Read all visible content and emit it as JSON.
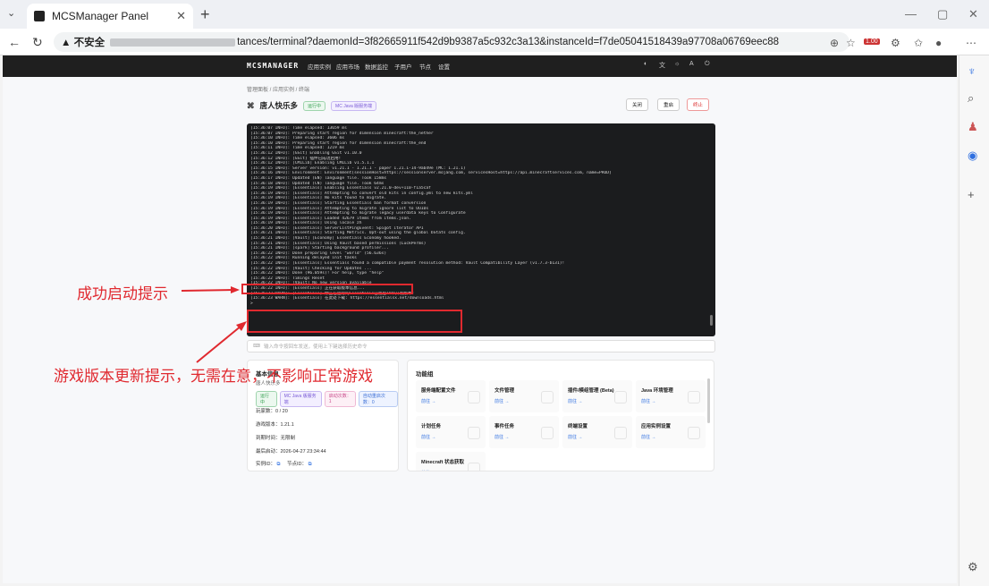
{
  "browser": {
    "tab_title": "MCSManager Panel",
    "security_label": "不安全",
    "url_visible": "tances/terminal?daemonId=3f82665911f542d9b9387a5c932c3a13&instanceId=f7de05041518439a97708a06769eec88",
    "window_controls": [
      "—",
      "▢",
      "✕"
    ],
    "extension_badge": "1.00"
  },
  "app": {
    "brand": "MCSMANAGER",
    "nav": [
      "应用实例",
      "应用市场",
      "数据监控",
      "子用户",
      "节点",
      "设置"
    ]
  },
  "breadcrumb": "管理面板  /  应用实例  /  终端",
  "instance": {
    "name": "唐人快乐多",
    "status_badge": "运行中",
    "type_badge": "MC Java 版服务端",
    "buttons": {
      "close": "关闭",
      "restart": "重启",
      "stop": "终止"
    }
  },
  "terminal": {
    "lines": [
      {
        "t": "[15:36:07 INFO]: Time elapsed: 13659 ms",
        "c": ""
      },
      {
        "t": "[15:36:07 INFO]: Preparing start region for dimension minecraft:the_nether",
        "c": ""
      },
      {
        "t": "[15:36:10 INFO]: Time elapsed: 3606 ms",
        "c": ""
      },
      {
        "t": "[15:36:10 INFO]: Preparing start region for dimension minecraft:the_end",
        "c": ""
      },
      {
        "t": "[15:36:11 INFO]: Time elapsed: 1219 ms",
        "c": ""
      },
      {
        "t": "[15:36:12 INFO]: [GSit] Enabling GSit v1.10.0",
        "c": ""
      },
      {
        "t": "[15:36:12 INFO]: [GSit] 插件已成功启用!",
        "c": "ylw"
      },
      {
        "t": "[15:36:12 INFO]: [CMILib] Enabling CMILib v1.5.1.1",
        "c": ""
      },
      {
        "t": "[15:36:15 INFO]: Server version: v1.21.1 - 1.21.1 - paper 1.21.1-14-9ab49e (MC: 1.21.1)",
        "c": ""
      },
      {
        "t": "[15:36:16 INFO]: Environment: Environment[sessionHost=https://sessionserver.mojang.com, servicesHost=https://api.minecraftservices.com, name=PROD]",
        "c": ""
      },
      {
        "t": "[15:36:17 INFO]: Updated (EN) language file. Took 158ms",
        "c": ""
      },
      {
        "t": "[15:36:18 INFO]: Updated (CN) language file. Took 64ms",
        "c": ""
      },
      {
        "t": "[15:36:19 INFO]: [Essentials] Enabling Essentials v2.21.0-dev+110-f1a5caf",
        "c": ""
      },
      {
        "t": "[15:36:19 INFO]: [Essentials] Attempting to convert old kits in config.yml to new kits.yml",
        "c": ""
      },
      {
        "t": "[15:36:19 INFO]: [Essentials] No kits found to migrate.",
        "c": ""
      },
      {
        "t": "[15:36:19 INFO]: [Essentials] Starting Essentials ban format conversion",
        "c": ""
      },
      {
        "t": "[15:36:19 INFO]: [Essentials] Attempting to migrate ignore list to UUIDs",
        "c": ""
      },
      {
        "t": "[15:36:19 INFO]: [Essentials] Attempting to migrate legacy userdata keys to Configurate",
        "c": ""
      },
      {
        "t": "[15:36:19 INFO]: [Essentials] Loaded 42679 items from items.json.",
        "c": ""
      },
      {
        "t": "[15:36:19 INFO]: [Essentials] Using locale zh",
        "c": ""
      },
      {
        "t": "[15:36:20 INFO]: [Essentials] ServerListPingEvent: Spigot iterator API",
        "c": ""
      },
      {
        "t": "[15:36:21 INFO]: [Essentials] Starting Metrics. Opt-out using the global bStats config.",
        "c": ""
      },
      {
        "t": "[15:36:21 INFO]: [Vault] [Economy] Essentials Economy hooked.",
        "c": ""
      },
      {
        "t": "[15:36:21 INFO]: [Essentials] Using Vault based permissions (LuckPerms)",
        "c": ""
      },
      {
        "t": "[15:36:21 INFO]: [spark] Starting background profiler...",
        "c": ""
      },
      {
        "t": "[15:36:22 INFO]: Done preparing level \"world\" (56.636s)",
        "c": ""
      },
      {
        "t": "[15:36:22 INFO]: Running delayed init tasks",
        "c": ""
      },
      {
        "t": "[15:36:22 INFO]: [Essentials] Essentials found a compatible payment resolution method: Vault Compatibility Layer (v1.7.3-b131)!",
        "c": ""
      },
      {
        "t": "[15:36:22 INFO]: [Vault] Checking for Updates ...",
        "c": ""
      },
      {
        "t": "[15:36:22 INFO]: Done (96.059s)! For help, type \"help\"",
        "c": ""
      },
      {
        "t": "[15:36:22 INFO]: Timings Reset",
        "c": ""
      },
      {
        "t": "[15:36:22 INFO]: [Vault] No new version available",
        "c": ""
      },
      {
        "t": "[15:36:22 INFO]: [Essentials] 正在获取版本信息...",
        "c": "ylw"
      },
      {
        "t": "",
        "c": ""
      },
      {
        "t": "[15:36:23 WARN]: [Essentials] 你正在运行的Essentials已落后10个开发版本!",
        "c": "wrn"
      },
      {
        "t": "[15:36:23 WARN]: [Essentials] 在此处下载: https://essentialsx.net/downloads.html",
        "c": "wrn"
      },
      {
        "t": ">",
        "c": ""
      }
    ]
  },
  "command_input": {
    "placeholder": "输入命令按回车发送，使用上下键选择历史命令"
  },
  "basic_info": {
    "title": "基本信息",
    "subtitle": "唐人快乐多",
    "badges": [
      "运行中",
      "MC Java 版服务端",
      "启动次数：1",
      "自动重启次数：0"
    ],
    "players": "玩家数：0 / 20",
    "version": "游戏版本：1.21.1",
    "expire": "到期时间：无限制",
    "last_start": "最后启动：2026-04-27 23:34:44",
    "ids": {
      "instance": "实例ID：",
      "node": "节点ID："
    }
  },
  "features": {
    "title": "功能组",
    "go_label": "前往 →",
    "items": [
      "服务端配置文件",
      "文件管理",
      "插件/模组管理 (Beta)",
      "Java 环境管理",
      "计划任务",
      "事件任务",
      "终端设置",
      "应用实例设置",
      "Minecraft 状态获取"
    ]
  },
  "annotations": {
    "success_label": "成功启动提示",
    "update_label": "游戏版本更新提示，无需在意，不影响正常游戏",
    "color": "#e0292f"
  }
}
